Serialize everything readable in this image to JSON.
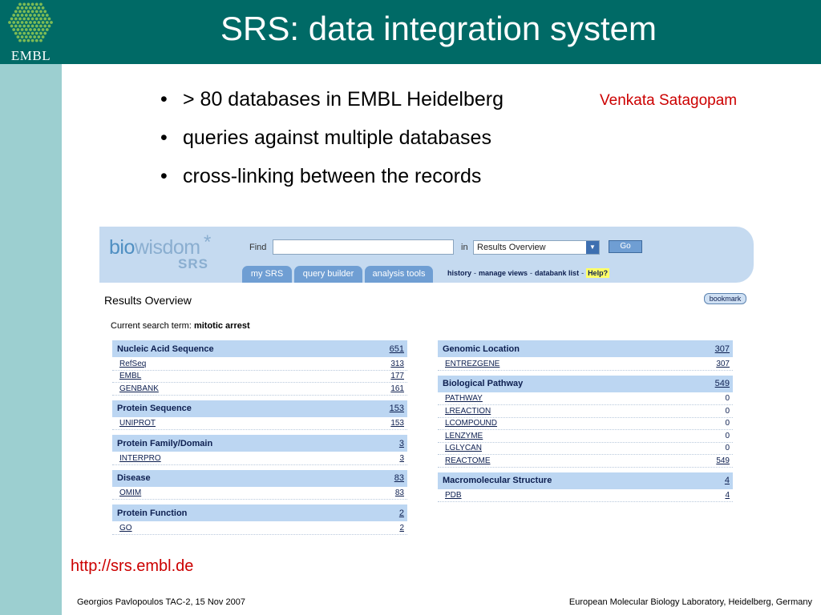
{
  "slide": {
    "logo_text": "EMBL",
    "title": "SRS: data integration system",
    "bullets": [
      "> 80 databases in EMBL Heidelberg",
      "queries against multiple databases",
      "cross-linking between the records"
    ],
    "author": "Venkata Satagopam",
    "url": "http://srs.embl.de",
    "footer_left": "Georgios Pavlopoulos TAC-2, 15 Nov 2007",
    "footer_right": "European Molecular Biology Laboratory, Heidelberg, Germany",
    "colors": {
      "header": "#006a66",
      "sidebar": "#9ccfd0",
      "accent_red": "#cc0000"
    }
  },
  "app": {
    "brand_bio": "bio",
    "brand_wisdom": "wisdom",
    "brand_star": "*",
    "brand_sub": "SRS",
    "find_label": "Find",
    "find_value": "",
    "in_label": "in",
    "select_value": "Results Overview",
    "go_label": "Go",
    "tabs": [
      "my SRS",
      "query builder",
      "analysis tools"
    ],
    "links": [
      "history",
      "manage views",
      "databank list"
    ],
    "help_label": "Help?",
    "page_title": "Results Overview",
    "bookmark_label": "bookmark",
    "search_term_label": "Current search term:",
    "search_term": "mitotic arrest",
    "left_column": [
      {
        "name": "Nucleic Acid Sequence",
        "count": "651",
        "rows": [
          {
            "name": "RefSeq",
            "count": "313"
          },
          {
            "name": "EMBL",
            "count": "177"
          },
          {
            "name": "GENBANK",
            "count": "161"
          }
        ]
      },
      {
        "name": "Protein Sequence",
        "count": "153",
        "rows": [
          {
            "name": "UNIPROT",
            "count": "153"
          }
        ]
      },
      {
        "name": "Protein Family/Domain",
        "count": "3",
        "rows": [
          {
            "name": "INTERPRO",
            "count": "3"
          }
        ]
      },
      {
        "name": "Disease",
        "count": "83",
        "rows": [
          {
            "name": "OMIM",
            "count": "83"
          }
        ]
      },
      {
        "name": "Protein Function",
        "count": "2",
        "rows": [
          {
            "name": "GO",
            "count": "2"
          }
        ]
      }
    ],
    "right_column": [
      {
        "name": "Genomic Location",
        "count": "307",
        "rows": [
          {
            "name": "ENTREZGENE",
            "count": "307"
          }
        ]
      },
      {
        "name": "Biological Pathway",
        "count": "549",
        "rows": [
          {
            "name": "PATHWAY",
            "count": "0"
          },
          {
            "name": "LREACTION",
            "count": "0"
          },
          {
            "name": "LCOMPOUND",
            "count": "0"
          },
          {
            "name": "LENZYME",
            "count": "0"
          },
          {
            "name": "LGLYCAN",
            "count": "0"
          },
          {
            "name": "REACTOME",
            "count": "549"
          }
        ]
      },
      {
        "name": "Macromolecular Structure",
        "count": "4",
        "rows": [
          {
            "name": "PDB",
            "count": "4"
          }
        ]
      }
    ]
  }
}
